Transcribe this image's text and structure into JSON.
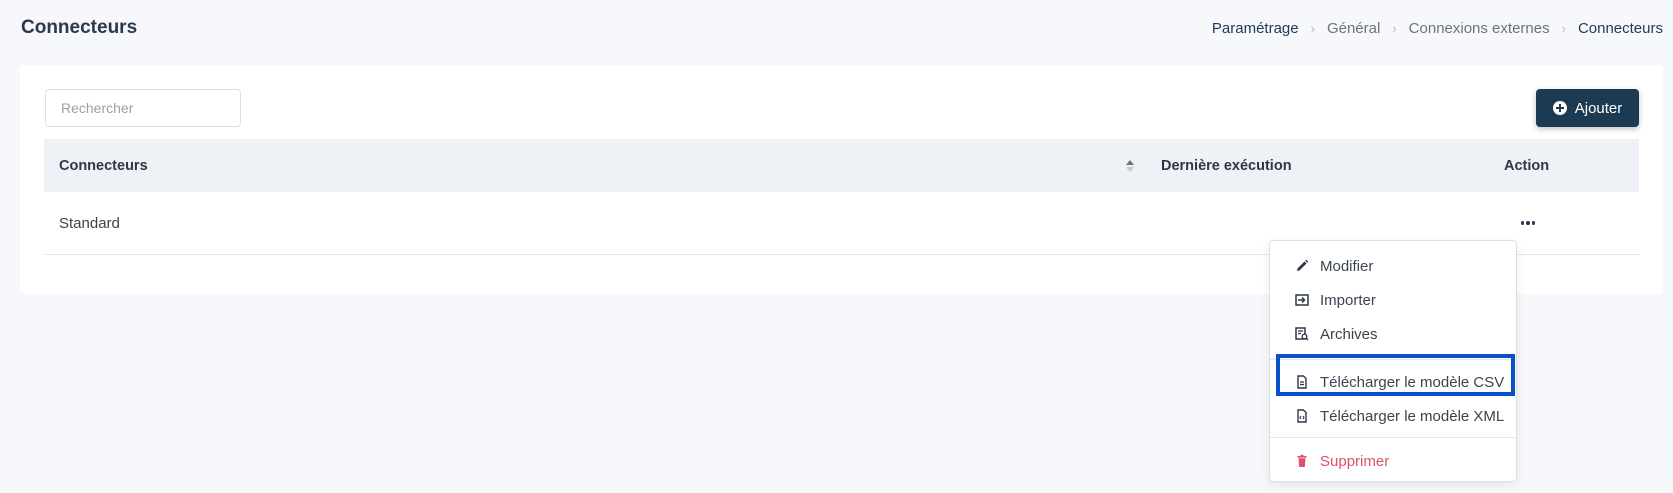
{
  "page": {
    "title": "Connecteurs",
    "breadcrumb": [
      "Paramétrage",
      "Général",
      "Connexions externes",
      "Connecteurs"
    ]
  },
  "toolbar": {
    "search_placeholder": "Rechercher",
    "add_label": "Ajouter"
  },
  "table": {
    "columns": [
      "Connecteurs",
      "Dernière exécution",
      "Action"
    ],
    "rows": [
      {
        "name": "Standard",
        "last_execution": ""
      }
    ]
  },
  "menu": {
    "items": [
      {
        "label": "Modifier",
        "icon": "pencil-icon"
      },
      {
        "label": "Importer",
        "icon": "import-icon"
      },
      {
        "label": "Archives",
        "icon": "archive-search-icon"
      },
      {
        "label": "Télécharger le modèle CSV",
        "icon": "file-icon"
      },
      {
        "label": "Télécharger le modèle XML",
        "icon": "file-code-icon"
      },
      {
        "label": "Supprimer",
        "icon": "trash-icon"
      }
    ]
  },
  "colors": {
    "primary": "#1c3a52",
    "danger": "#e0506a",
    "highlight": "#0a4fcc"
  }
}
